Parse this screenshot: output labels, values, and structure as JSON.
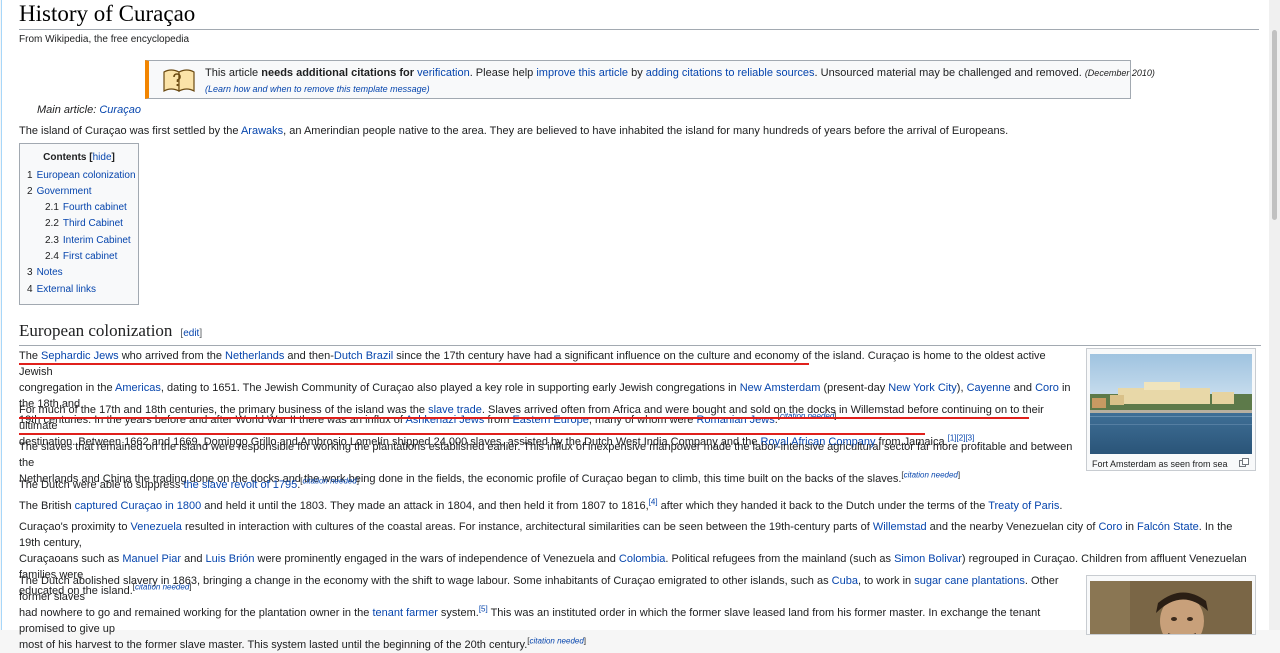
{
  "title": "History of Curaçao",
  "site_sub": "From Wikipedia, the free encyclopedia",
  "ambox": {
    "t1": "This article ",
    "t2": "needs additional citations for ",
    "t3": "verification",
    "t4": ". Please help ",
    "t5": "improve this article",
    "t6": " by ",
    "t7": "adding citations to reliable sources",
    "t8": ". Unsourced material may be challenged and removed.",
    "date": "(December 2010)",
    "learn": "(Learn how and when to remove this template message)"
  },
  "hatnote": {
    "prefix": "Main article: ",
    "link": "Curaçao"
  },
  "intro": {
    "a": "The island of Curaçao was first settled by the ",
    "link": "Arawaks",
    "b": ", an Amerindian people native to the area. They are believed to have inhabited the island for many hundreds of years before the arrival of Europeans."
  },
  "toc": {
    "title": "Contents",
    "hide": "hide",
    "items": [
      {
        "num": "1",
        "label": "European colonization"
      },
      {
        "num": "2",
        "label": "Government"
      },
      {
        "num": "2.1",
        "label": "Fourth cabinet"
      },
      {
        "num": "2.2",
        "label": "Third Cabinet"
      },
      {
        "num": "2.3",
        "label": "Interim Cabinet"
      },
      {
        "num": "2.4",
        "label": "First cabinet"
      },
      {
        "num": "3",
        "label": "Notes"
      },
      {
        "num": "4",
        "label": "External links"
      }
    ]
  },
  "section": {
    "title": "European colonization",
    "edit": "edit"
  },
  "p1": {
    "s1": "The ",
    "l1": "Sephardic Jews",
    "s2": " who arrived from the ",
    "l2": "Netherlands",
    "s3": " and then-",
    "l3": "Dutch Brazil",
    "s4": " since the 17th century have had a significant influence on the culture and economy of the island. Curaçao is home to the oldest active Jewish",
    "s5": "congregation in the ",
    "l4": "Americas",
    "s6": ", dating to 1651. The Jewish Community of Curaçao also played a key role in supporting early Jewish congregations in ",
    "l5": "New Amsterdam",
    "s7": " (present-day ",
    "l6": "New York City",
    "s8": "), ",
    "l7": "Cayenne",
    "s9": " and ",
    "l8": "Coro",
    "s10": " in the 18th and",
    "s11": "19th centuries. In the years before and after World War II there was an influx of ",
    "l9": "Ashkenazi Jews",
    "s12": " from ",
    "l10": "Eastern Europe",
    "s13": ", many of whom were ",
    "l11": "Romanian Jews",
    "s14": ".",
    "cn": "citation needed"
  },
  "p2": {
    "s1": "For much of the 17th and 18th centuries, the primary business of the island was the ",
    "l1": "slave trade",
    "s2": ". Slaves arrived often from Africa and were bought and sold on the docks in Willemstad before continuing on to their ultimate",
    "s3": "destination. Between 1662 and 1669, Domingo Grillo and Ambrosio Lomelín shipped 24,000 slaves, assisted by the Dutch West India Company and the ",
    "l2": "Royal African Company",
    "s4": " from Jamaica.",
    "r1": "[1]",
    "r2": "[2]",
    "r3": "[3]"
  },
  "p3": {
    "s1": "The slaves that remained on the island were responsible for working the plantations established earlier. This influx of inexpensive manpower made the labor-intensive agricultural sector far more profitable and between the",
    "s2": "Netherlands and China the trading done on the docks and the work being done in the fields, the economic profile of Curaçao began to climb, this time built on the backs of the slaves.",
    "cn": "citation needed"
  },
  "p4": {
    "s1": "The Dutch were able to suppress ",
    "l1": "the slave revolt of 1795",
    "s2": ".",
    "cn": "citation needed"
  },
  "p5": {
    "s1": "The British ",
    "l1": "captured Curaçao in 1800",
    "s2": " and held it until the 1803. They made an attack in 1804, and then held it from 1807 to 1816,",
    "r1": "[4]",
    "s3": " after which they handed it back to the Dutch under the terms of the ",
    "l2": "Treaty of Paris",
    "s4": "."
  },
  "p6": {
    "s1": "Curaçao's proximity to ",
    "l1": "Venezuela",
    "s2": " resulted in interaction with cultures of the coastal areas. For instance, architectural similarities can be seen between the 19th-century parts of ",
    "l2": "Willemstad",
    "s3": " and the nearby Venezuelan city of ",
    "l3": "Coro",
    "s4": " in ",
    "l4": "Falcón State",
    "s5": ". In the 19th century,",
    "s6": "Curaçaoans such as ",
    "l5": "Manuel Piar",
    "s7": " and ",
    "l6": "Luis Brión",
    "s8": " were prominently engaged in the wars of independence of Venezuela and ",
    "l7": "Colombia",
    "s9": ". Political refugees from the mainland (such as ",
    "l8": "Simon Bolivar",
    "s10": ") regrouped in Curaçao. Children from affluent Venezuelan families were",
    "s11": "educated on the island.",
    "cn": "citation needed"
  },
  "p7": {
    "s1": "The Dutch abolished slavery in 1863, bringing a change in the economy with the shift to wage labour. Some inhabitants of Curaçao emigrated to other islands, such as ",
    "l1": "Cuba",
    "s2": ", to work in ",
    "l2": "sugar cane plantations",
    "s3": ". Other former slaves",
    "s4": "had nowhere to go and remained working for the plantation owner in the ",
    "l3": "tenant farmer",
    "s5": " system.",
    "r1": "[5]",
    "s6": " This was an instituted order in which the former slave leased land from his former master. In exchange the tenant promised to give up",
    "s7": "most of his harvest to the former slave master. This system lasted until the beginning of the 20th century.",
    "cn": "citation needed"
  },
  "thumb1": {
    "caption": "Fort Amsterdam as seen from sea"
  },
  "colors": {
    "link": "#0645ad",
    "ambox_border": "#f28500",
    "annotation": "#e0201c"
  }
}
